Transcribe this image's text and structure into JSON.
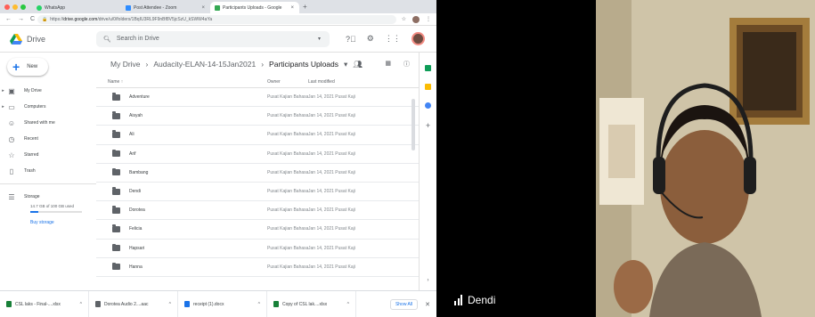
{
  "chrome": {
    "tabs": [
      {
        "label": "WhatsApp",
        "color": "#25d366"
      },
      {
        "label": "Post Attendee - Zoom",
        "color": "#2d8cff"
      },
      {
        "label": "Participants Uploads - Google",
        "color": "#34a853"
      }
    ],
    "url_prefix": "https://",
    "url_host": "drive.google.com",
    "url_path": "/drive/u/0/folders/1BqIU3RL9F9nBf8V5jcSzU_kSWW4aYa"
  },
  "drive": {
    "app_name": "Drive",
    "search_placeholder": "Search in Drive",
    "new_label": "New",
    "sidebar": [
      {
        "label": "My Drive",
        "icon": "my-drive-icon",
        "glyph": "▣",
        "expandable": true
      },
      {
        "label": "Computers",
        "icon": "computers-icon",
        "glyph": "▭",
        "expandable": true
      },
      {
        "label": "Shared with me",
        "icon": "shared-icon",
        "glyph": "☺",
        "expandable": false
      },
      {
        "label": "Recent",
        "icon": "recent-icon",
        "glyph": "◷",
        "expandable": false
      },
      {
        "label": "Starred",
        "icon": "star-icon",
        "glyph": "☆",
        "expandable": false
      },
      {
        "label": "Trash",
        "icon": "trash-icon",
        "glyph": "🗑",
        "expandable": false
      }
    ],
    "storage": {
      "label": "Storage",
      "usage": "14.7 GB of 100 GB used",
      "fraction_used": 0.147,
      "buy_label": "Buy storage"
    },
    "breadcrumb": [
      "My Drive",
      "Audacity-ELAN-14-15Jan2021",
      "Participants Uploads"
    ],
    "columns": {
      "name": "Name",
      "owner": "Owner",
      "modified": "Last modified"
    },
    "files": [
      {
        "name": "Adventure",
        "owner": "Pusat Kajian Bahasa da",
        "modified": "Jan 14, 2021 Pusat Kaji"
      },
      {
        "name": "Aisyah",
        "owner": "Pusat Kajian Bahasa da",
        "modified": "Jan 14, 2021 Pusat Kaji"
      },
      {
        "name": "Ali",
        "owner": "Pusat Kajian Bahasa da",
        "modified": "Jan 14, 2021 Pusat Kaji"
      },
      {
        "name": "Arif",
        "owner": "Pusat Kajian Bahasa da",
        "modified": "Jan 14, 2021 Pusat Kaji"
      },
      {
        "name": "Bambang",
        "owner": "Pusat Kajian Bahasa da",
        "modified": "Jan 14, 2021 Pusat Kaji"
      },
      {
        "name": "Dendi",
        "owner": "Pusat Kajian Bahasa da",
        "modified": "Jan 14, 2021 Pusat Kaji"
      },
      {
        "name": "Dorotea",
        "owner": "Pusat Kajian Bahasa da",
        "modified": "Jan 14, 2021 Pusat Kaji"
      },
      {
        "name": "Felicia",
        "owner": "Pusat Kajian Bahasa da",
        "modified": "Jan 14, 2021 Pusat Kaji"
      },
      {
        "name": "Hapsari",
        "owner": "Pusat Kajian Bahasa da",
        "modified": "Jan 14, 2021 Pusat Kaji"
      },
      {
        "name": "Hanna",
        "owner": "Pusat Kajian Bahasa da",
        "modified": "Jan 14, 2021 Pusat Kaji"
      }
    ]
  },
  "downloads": {
    "items": [
      {
        "label": "CSL laks - Final-....xlsx",
        "color": "#188038"
      },
      {
        "label": "Dorotea Audio 2....aac",
        "color": "#5f6368"
      },
      {
        "label": "receipt (1).docx",
        "color": "#1a73e8"
      },
      {
        "label": "Copy of CSL lak....xlsx",
        "color": "#188038"
      }
    ],
    "show_all": "Show All"
  },
  "zoom": {
    "participant_name": "Dendi"
  }
}
